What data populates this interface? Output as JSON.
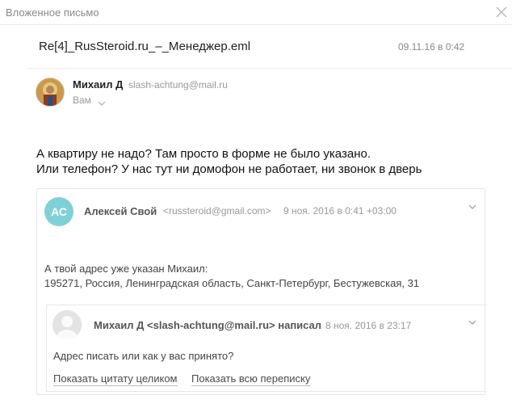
{
  "window": {
    "title": "Вложенное письмо",
    "close_icon": "close-icon"
  },
  "message": {
    "file_name": "Re[4]_RusSteroid.ru_–_Менеджер.eml",
    "date": "09.11.16 в 0:42",
    "sender_name": "Михаил Д",
    "sender_email": "slash-achtung@mail.ru",
    "recipient": "Вам",
    "body_lines": [
      "А квартиру не надо? Там просто в форме не было указано.",
      "Или телефон? У нас тут ни домофон не работает, ни звонок в дверь"
    ]
  },
  "quote": {
    "avatar_initials": "АС",
    "avatar_color": "#7fd1d7",
    "author_name": "Алексей Свой",
    "author_email": "<russteroid@gmail.com>",
    "date": "9 ноя. 2016 в 0:41 +03:00",
    "lines": [
      "А твой адрес уже указан Михаил:",
      "195271, Россия, Ленинградская область, Санкт-Петербург, Бестужевская, 31"
    ],
    "nested": {
      "header": "Михаил Д <slash-achtung@mail.ru> написал",
      "date": "8 ноя. 2016 в 23:17",
      "text": "Адрес писать или как у вас принято?",
      "show_quote_label": "Показать цитату целиком",
      "show_thread_label": "Показать всю переписку"
    }
  }
}
